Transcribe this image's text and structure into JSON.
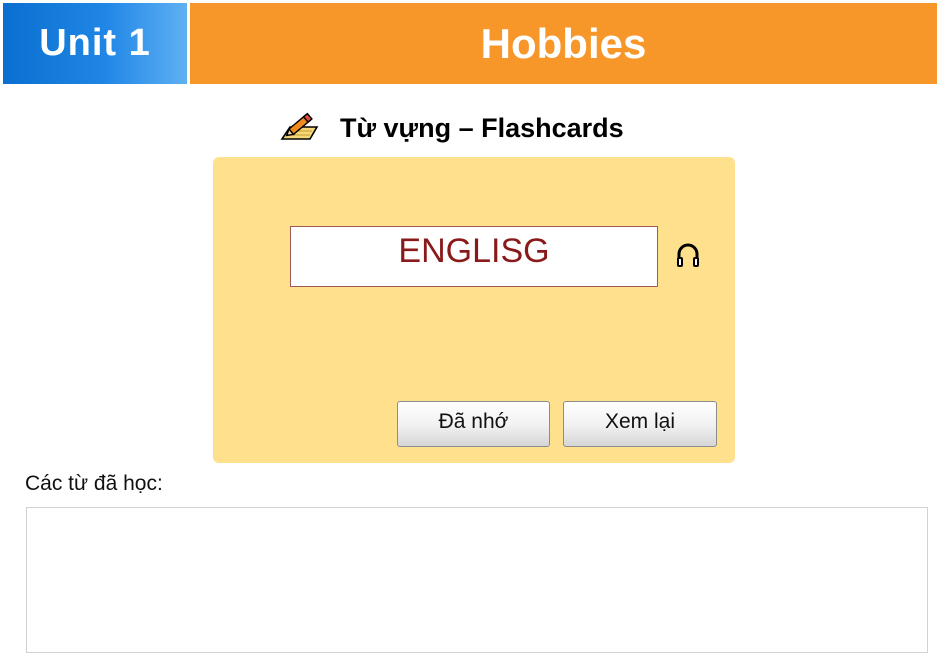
{
  "header": {
    "unit_label": "Unit 1",
    "title": "Hobbies"
  },
  "section": {
    "icon": "pencil-paper-icon",
    "title": "Từ vựng – Flashcards"
  },
  "flashcard": {
    "word": "ENGLISG",
    "audio_icon": "headphones-icon",
    "remember_button": "Đã nhớ",
    "review_button": "Xem lại"
  },
  "learned": {
    "label": "Các từ đã học:",
    "words": []
  },
  "colors": {
    "unit_blue": "#1f86e6",
    "title_orange": "#f7972a",
    "card_yellow": "#ffe08c",
    "word_red": "#8a1a1a"
  }
}
